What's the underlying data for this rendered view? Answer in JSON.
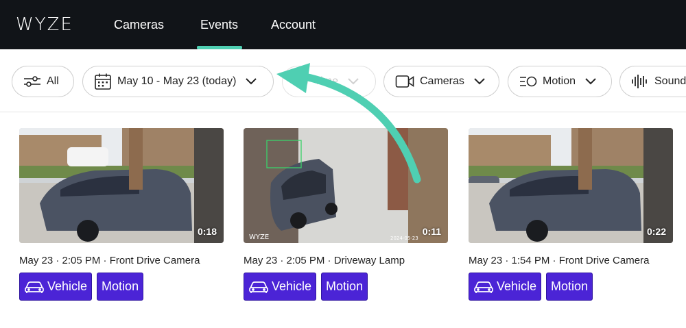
{
  "brand": {
    "logo_text": "WYZE",
    "accent": "#4fcfb2",
    "tag_color": "#4b24d6"
  },
  "nav": {
    "items": [
      {
        "label": "Cameras",
        "active": false
      },
      {
        "label": "Events",
        "active": true
      },
      {
        "label": "Account",
        "active": false
      }
    ]
  },
  "filters": {
    "all_label": "All",
    "date_label": "May 10 - May 23 (today)",
    "time_label": "Time",
    "cameras_label": "Cameras",
    "motion_label": "Motion",
    "sound_label": "Sound"
  },
  "events": [
    {
      "duration": "0:18",
      "meta": "May 23 · 2:05 PM · Front Drive Camera",
      "tags": [
        "Vehicle",
        "Motion"
      ]
    },
    {
      "duration": "0:11",
      "meta": "May 23 · 2:05 PM · Driveway Lamp",
      "tags": [
        "Vehicle",
        "Motion"
      ],
      "watermark": "WYZE",
      "timestamp": "2024-05-23"
    },
    {
      "duration": "0:22",
      "meta": "May 23 · 1:54 PM · Front Drive Camera",
      "tags": [
        "Vehicle",
        "Motion"
      ]
    }
  ],
  "icons": [
    "filter-sliders-icon",
    "calendar-icon",
    "chevron-down-icon",
    "clock-icon",
    "camera-icon",
    "motion-icon",
    "sound-wave-icon",
    "car-icon"
  ]
}
